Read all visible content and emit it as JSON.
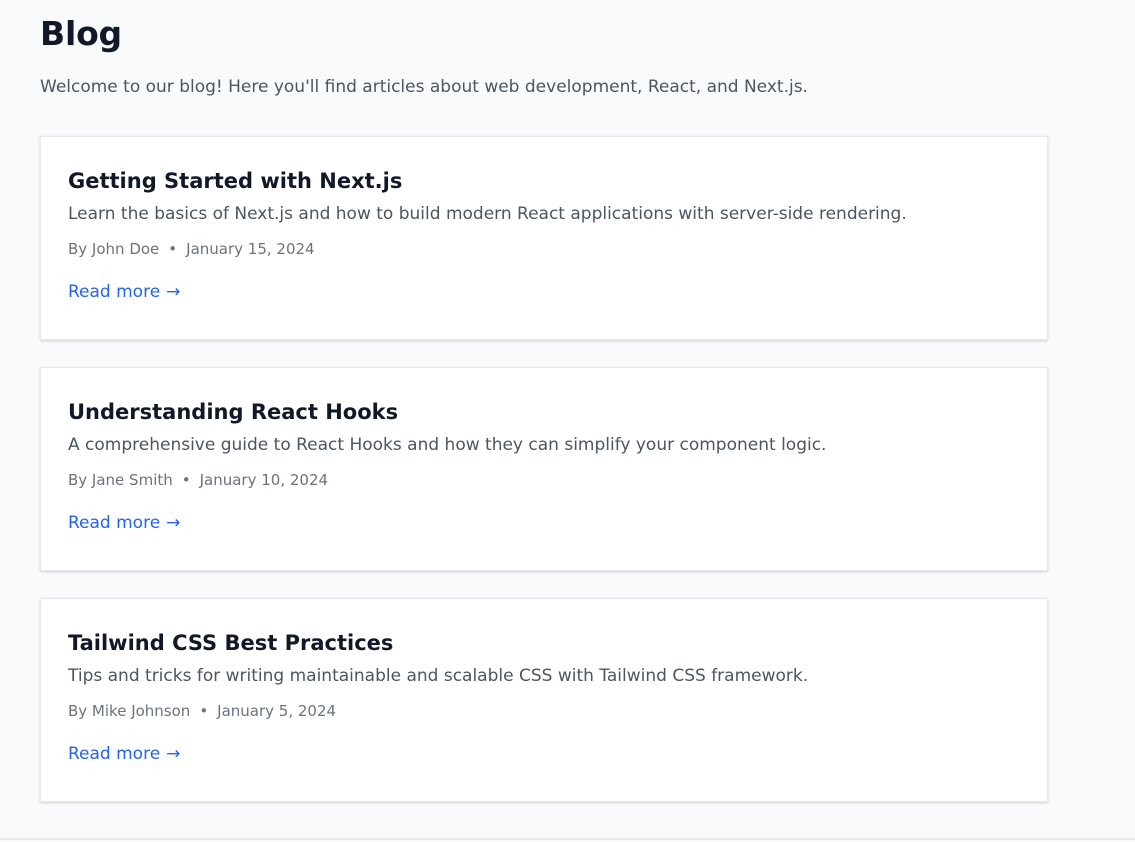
{
  "page": {
    "title": "Blog",
    "intro": "Welcome to our blog! Here you'll find articles about web development, React, and Next.js."
  },
  "posts": [
    {
      "title": "Getting Started with Next.js",
      "excerpt": "Learn the basics of Next.js and how to build modern React applications with server-side rendering.",
      "author": "By John Doe",
      "date": "January 15, 2024",
      "link_label": "Read more",
      "link_arrow": "→"
    },
    {
      "title": "Understanding React Hooks",
      "excerpt": "A comprehensive guide to React Hooks and how they can simplify your component logic.",
      "author": "By Jane Smith",
      "date": "January 10, 2024",
      "link_label": "Read more",
      "link_arrow": "→"
    },
    {
      "title": "Tailwind CSS Best Practices",
      "excerpt": "Tips and tricks for writing maintainable and scalable CSS with Tailwind CSS framework.",
      "author": "By Mike Johnson",
      "date": "January 5, 2024",
      "link_label": "Read more",
      "link_arrow": "→"
    }
  ],
  "meta_separator": "•",
  "colors": {
    "background": "#f9fafb",
    "card": "#ffffff",
    "heading": "#111827",
    "body_text": "#4b5563",
    "meta_text": "#6b7280",
    "link": "#2563eb",
    "border": "#e5e7eb"
  },
  "icons": {
    "read_more": "arrow-right-icon",
    "meta_separator": "dot-separator-icon"
  }
}
